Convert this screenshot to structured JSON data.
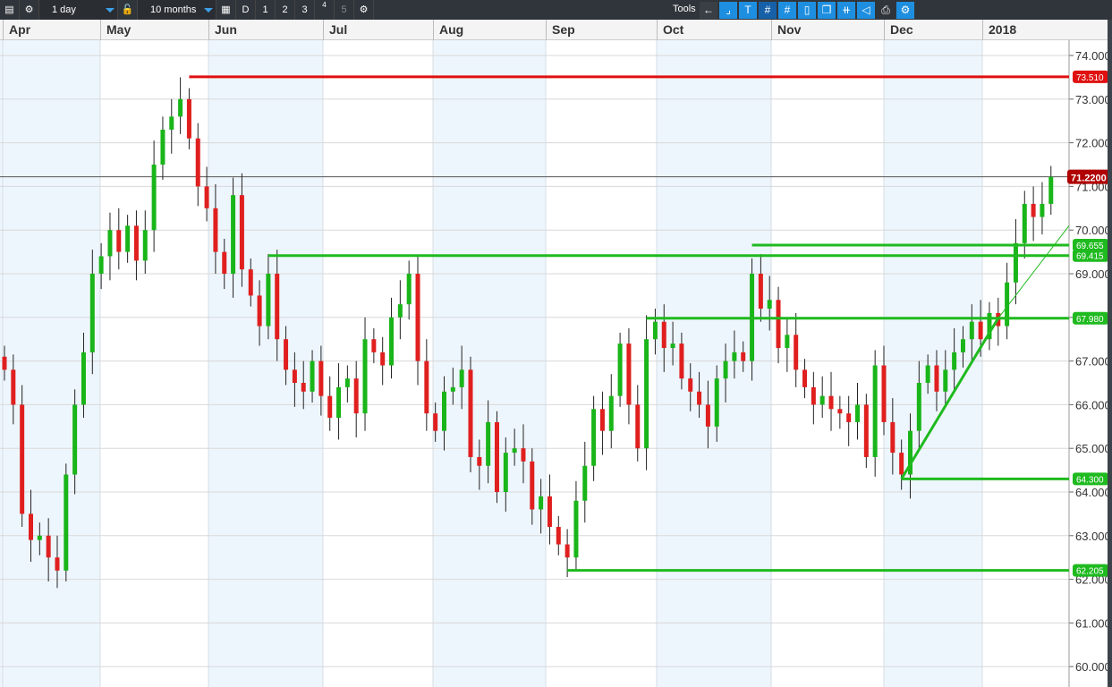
{
  "toolbar": {
    "interval": "1 day",
    "range": "10 months",
    "d": "D",
    "n1": "1",
    "n2": "2",
    "n3": "3",
    "n4": "4",
    "n5": "5",
    "tools": "Tools"
  },
  "months": [
    "Apr",
    "May",
    "Jun",
    "Jul",
    "Aug",
    "Sep",
    "Oct",
    "Nov",
    "Dec",
    "2018"
  ],
  "colors": {
    "up": "#19b519",
    "down": "#e01f1f",
    "band": "#eef6fd",
    "level_green": "#1fba1f",
    "level_red": "#e01010",
    "last": "#b00000"
  },
  "chart_data": {
    "type": "candlestick",
    "x_labels": [
      "Apr",
      "May",
      "Jun",
      "Jul",
      "Aug",
      "Sep",
      "Oct",
      "Nov",
      "Dec",
      "2018"
    ],
    "y_ticks": [
      "60.000",
      "61.000",
      "62.000",
      "63.000",
      "64.000",
      "65.000",
      "66.000",
      "67.000",
      "68.000",
      "69.000",
      "70.000",
      "71.000",
      "72.000",
      "73.000",
      "74.000"
    ],
    "ylim": [
      59.7,
      74.3
    ],
    "closes": [
      66.8,
      66.0,
      63.5,
      62.9,
      63.0,
      62.5,
      62.2,
      64.4,
      66.0,
      67.2,
      69.0,
      69.4,
      70.0,
      69.5,
      70.1,
      69.3,
      70.0,
      71.5,
      72.3,
      72.6,
      73.0,
      72.1,
      71.0,
      70.5,
      69.5,
      69.0,
      70.8,
      69.1,
      68.5,
      67.8,
      69.0,
      67.5,
      66.8,
      66.5,
      66.3,
      67.0,
      66.2,
      65.7,
      66.4,
      66.6,
      65.8,
      67.5,
      67.2,
      66.9,
      68.0,
      68.3,
      69.0,
      67.0,
      65.8,
      65.4,
      66.3,
      66.4,
      66.8,
      64.8,
      64.6,
      65.6,
      64.0,
      64.9,
      65.0,
      64.7,
      63.6,
      63.9,
      63.2,
      62.8,
      62.5,
      63.8,
      64.6,
      65.9,
      65.4,
      66.2,
      67.4,
      66.0,
      65.0,
      67.5,
      67.9,
      67.3,
      67.4,
      66.6,
      66.3,
      66.0,
      65.5,
      66.6,
      67.0,
      67.2,
      67.0,
      69.0,
      68.2,
      68.4,
      67.3,
      67.6,
      66.8,
      66.4,
      66.0,
      66.2,
      65.9,
      65.8,
      65.6,
      66.0,
      64.8,
      66.9,
      65.6,
      64.9,
      64.4,
      65.4,
      66.5,
      66.9,
      66.3,
      66.8,
      67.2,
      67.5,
      67.9,
      67.5,
      68.1,
      67.8,
      68.8,
      69.7,
      70.6,
      70.3,
      70.6,
      71.22
    ],
    "levels": [
      {
        "price": 73.51,
        "label": "73.510",
        "color": "red",
        "from_index": 21
      },
      {
        "price": 69.655,
        "label": "69.655",
        "color": "green",
        "from_index": 85
      },
      {
        "price": 69.415,
        "label": "69.415",
        "color": "green",
        "from_index": 30
      },
      {
        "price": 67.98,
        "label": "67.980",
        "color": "green",
        "from_index": 73
      },
      {
        "price": 64.3,
        "label": "64.300",
        "color": "green",
        "from_index": 102
      },
      {
        "price": 62.205,
        "label": "62.205",
        "color": "green",
        "from_index": 64
      }
    ],
    "last_price": {
      "price": 71.22,
      "label": "71.2200"
    },
    "trendline": {
      "from": [
        102,
        64.3
      ],
      "to": [
        113,
        67.98
      ]
    }
  }
}
